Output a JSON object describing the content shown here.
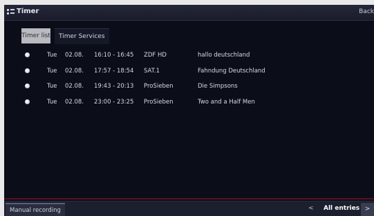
{
  "header": {
    "title": "Timer",
    "back_label": "Back"
  },
  "tabs": [
    {
      "label": "Timer list",
      "active": true
    },
    {
      "label": "Timer Services",
      "active": false
    }
  ],
  "timers": [
    {
      "day": "Tue",
      "date": "02.08.",
      "time": "16:10 - 16:45",
      "channel": "ZDF HD",
      "title": "hallo deutschland"
    },
    {
      "day": "Tue",
      "date": "02.08.",
      "time": "17:57 - 18:54",
      "channel": "SAT.1",
      "title": "Fahndung Deutschland"
    },
    {
      "day": "Tue",
      "date": "02.08.",
      "time": "19:43 - 20:13",
      "channel": "ProSieben",
      "title": "Die Simpsons"
    },
    {
      "day": "Tue",
      "date": "02.08.",
      "time": "23:00 - 23:25",
      "channel": "ProSieben",
      "title": "Two and a Half Men"
    }
  ],
  "footer": {
    "manual_recording_label": "Manual recording",
    "filter_label": "All entries",
    "prev_glyph": "<",
    "next_glyph": ">"
  },
  "colors": {
    "background": "#0b0d18",
    "active_tab": "#b8bac0",
    "accent_line": "#5a1020"
  },
  "icons": {
    "app": "timer-list-icon",
    "row_marker": "bullet-dot-icon"
  }
}
